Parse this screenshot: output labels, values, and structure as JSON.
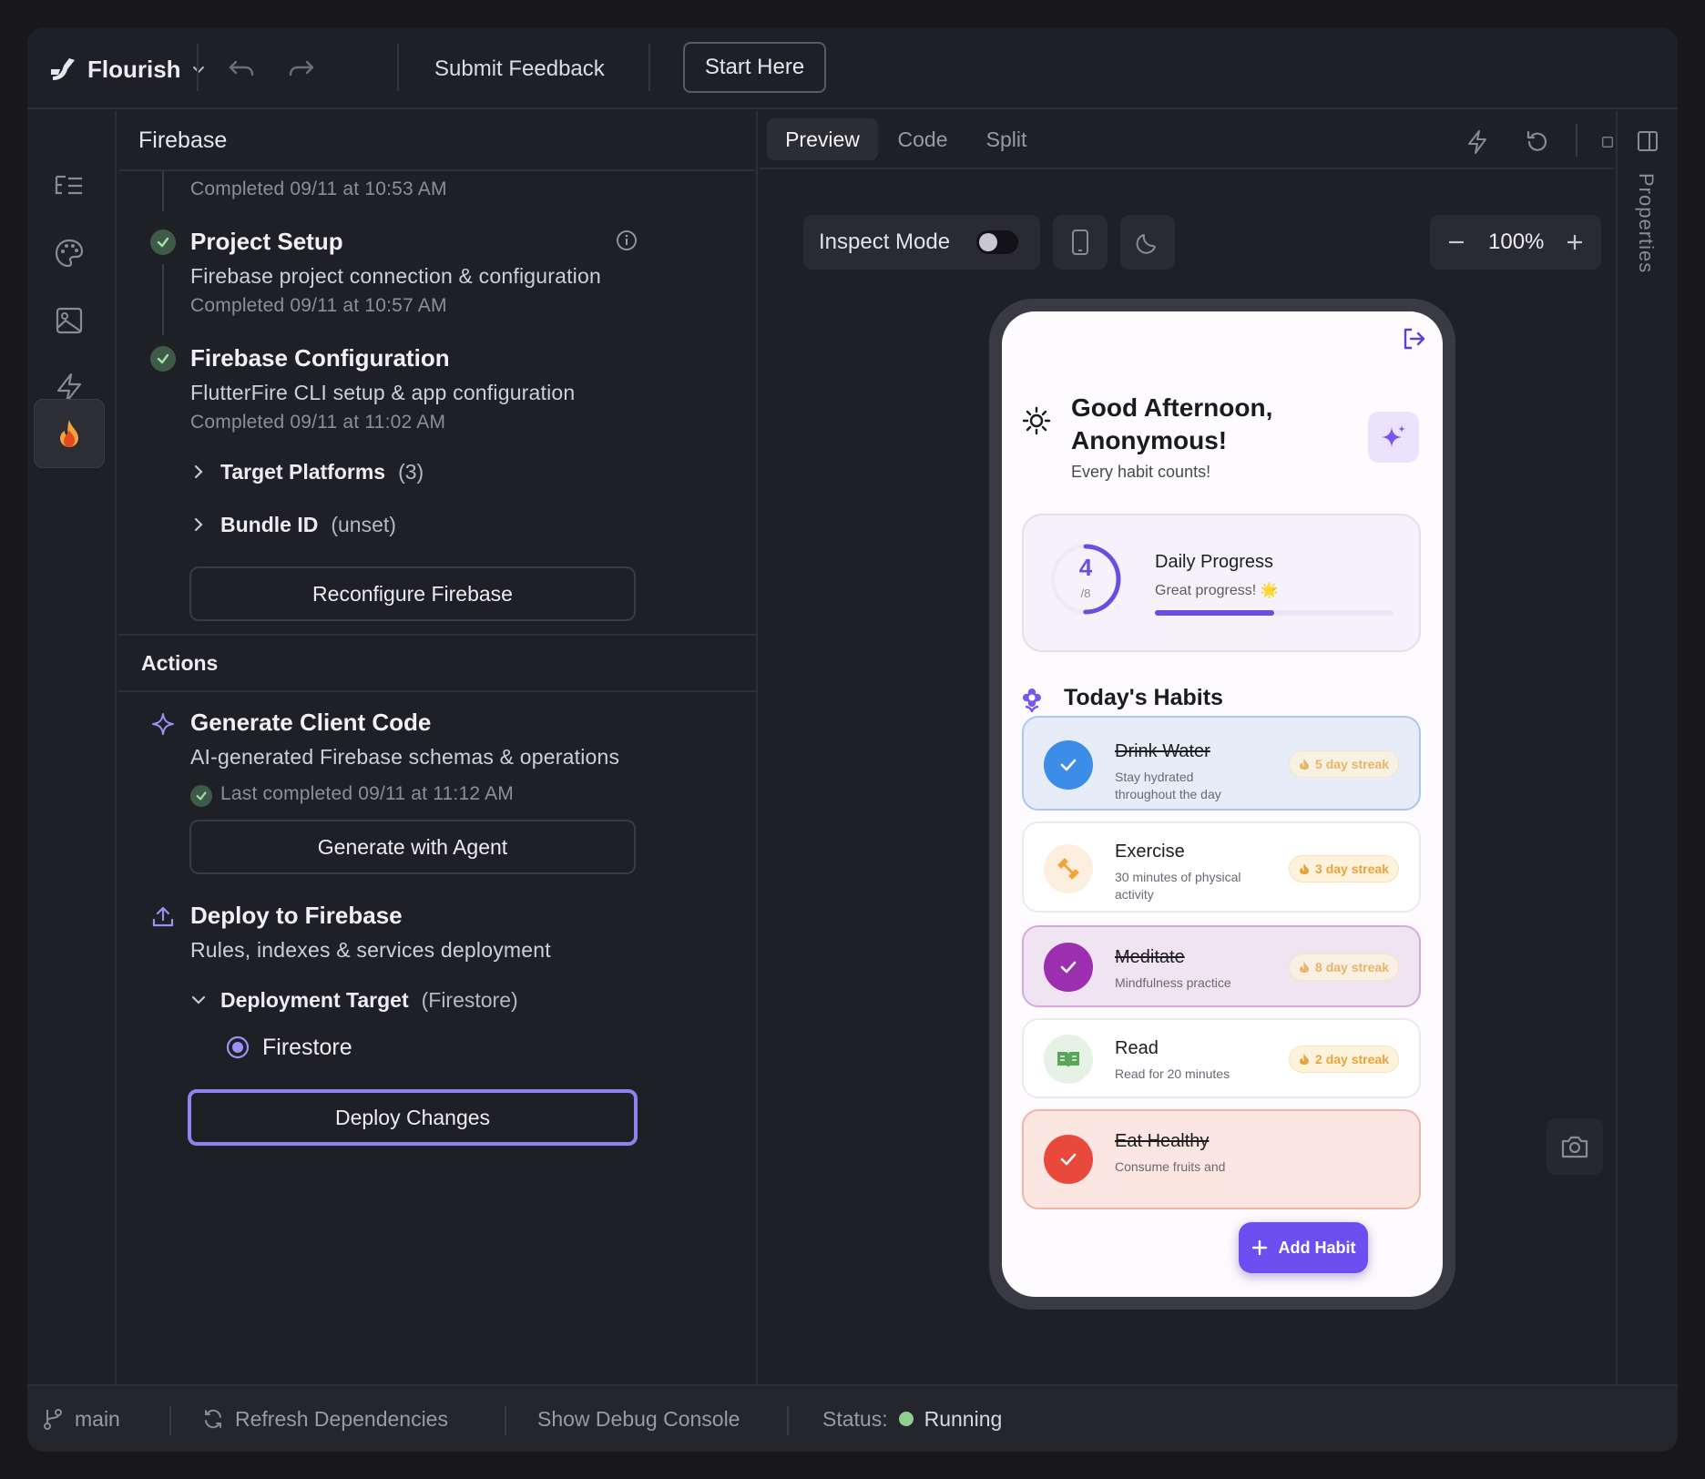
{
  "topbar": {
    "app_name": "Flourish",
    "submit_feedback": "Submit Feedback",
    "start_here": "Start Here"
  },
  "panel": {
    "title": "Firebase",
    "prev_completed": "Completed 09/11 at 10:53 AM",
    "steps": [
      {
        "title": "Project Setup",
        "desc": "Firebase project connection & configuration",
        "completed": "Completed 09/11 at 10:57 AM"
      },
      {
        "title": "Firebase Configuration",
        "desc": "FlutterFire CLI setup & app configuration",
        "completed": "Completed 09/11 at 11:02 AM"
      }
    ],
    "target_platforms": {
      "label": "Target Platforms",
      "value": "(3)"
    },
    "bundle_id": {
      "label": "Bundle ID",
      "value": "(unset)"
    },
    "reconfigure_button": "Reconfigure Firebase",
    "actions_title": "Actions",
    "generate": {
      "title": "Generate Client Code",
      "desc": "AI-generated Firebase schemas & operations",
      "last": "Last completed 09/11 at 11:12 AM",
      "button": "Generate with Agent"
    },
    "deploy": {
      "title": "Deploy to Firebase",
      "desc": "Rules, indexes & services deployment",
      "target_label": "Deployment Target",
      "target_value": "(Firestore)",
      "option": "Firestore",
      "button": "Deploy Changes"
    }
  },
  "preview": {
    "tabs": [
      "Preview",
      "Code",
      "Split"
    ],
    "inspect_mode": "Inspect Mode",
    "zoom": "100%",
    "properties_label": "Properties"
  },
  "app": {
    "greeting": "Good Afternoon, Anonymous!",
    "greeting_sub": "Every habit counts!",
    "progress": {
      "done": "4",
      "total": "/8",
      "fraction": 0.5,
      "title": "Daily Progress",
      "subtitle": "Great progress! 🌟"
    },
    "habits_title": "Today's Habits",
    "habits": [
      {
        "name": "Drink Water",
        "desc": "Stay hydrated throughout the day",
        "streak": "5 day streak",
        "done": true
      },
      {
        "name": "Exercise",
        "desc": "30 minutes of physical activity",
        "streak": "3 day streak",
        "done": false
      },
      {
        "name": "Meditate",
        "desc": "Mindfulness practice",
        "streak": "8 day streak",
        "done": true
      },
      {
        "name": "Read",
        "desc": "Read for 20 minutes",
        "streak": "2 day streak",
        "done": false
      },
      {
        "name": "Eat Healthy",
        "desc": "Consume fruits and",
        "streak": "",
        "done": true
      }
    ],
    "add_habit": "Add Habit"
  },
  "statusbar": {
    "branch": "main",
    "refresh": "Refresh Dependencies",
    "debug": "Show Debug Console",
    "status_label": "Status:",
    "status_value": "Running"
  },
  "colors": {
    "accent": "#8e83ef",
    "app_primary": "#6c4ff0",
    "success": "#8fcf8f",
    "streak": "#e8a33a"
  }
}
